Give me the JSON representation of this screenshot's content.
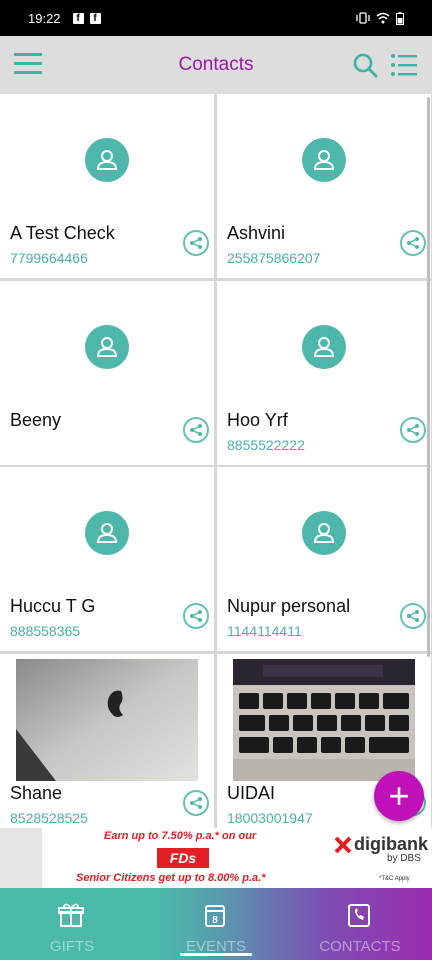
{
  "status_bar": {
    "time": "19:22"
  },
  "app_bar": {
    "title": "Contacts"
  },
  "contacts": [
    {
      "name": "A Test Check",
      "phone": "7799664466"
    },
    {
      "name": "Ashvini",
      "phone": "255875866207"
    },
    {
      "name": "Beeny",
      "phone": ""
    },
    {
      "name": "Hoo Yrf",
      "phone": "8855522222"
    },
    {
      "name": "Huccu T G",
      "phone": "888558365"
    },
    {
      "name": "Nupur personal",
      "phone": "1144114411"
    },
    {
      "name": "Shane",
      "phone": "8528528525"
    },
    {
      "name": "UIDAI",
      "phone": "18003001947"
    }
  ],
  "ad": {
    "line1": "Earn up to 7.50% p.a.* on our",
    "highlight": "FDs",
    "line3": "Senior Citizens get up to 8.00% p.a.*",
    "brand": "digibank",
    "brand_sub": "by DBS",
    "terms": "*T&C Apply"
  },
  "fab": {
    "label": "+"
  },
  "bottom_nav": [
    {
      "label": "GIFTS",
      "icon": "gift-icon"
    },
    {
      "label": "EVENTS",
      "icon": "calendar-icon"
    },
    {
      "label": "CONTACTS",
      "icon": "contact-book-icon"
    }
  ],
  "colors": {
    "accent": "#4cb7aa",
    "title": "#9a1aa3",
    "fab": "#c010b8"
  }
}
